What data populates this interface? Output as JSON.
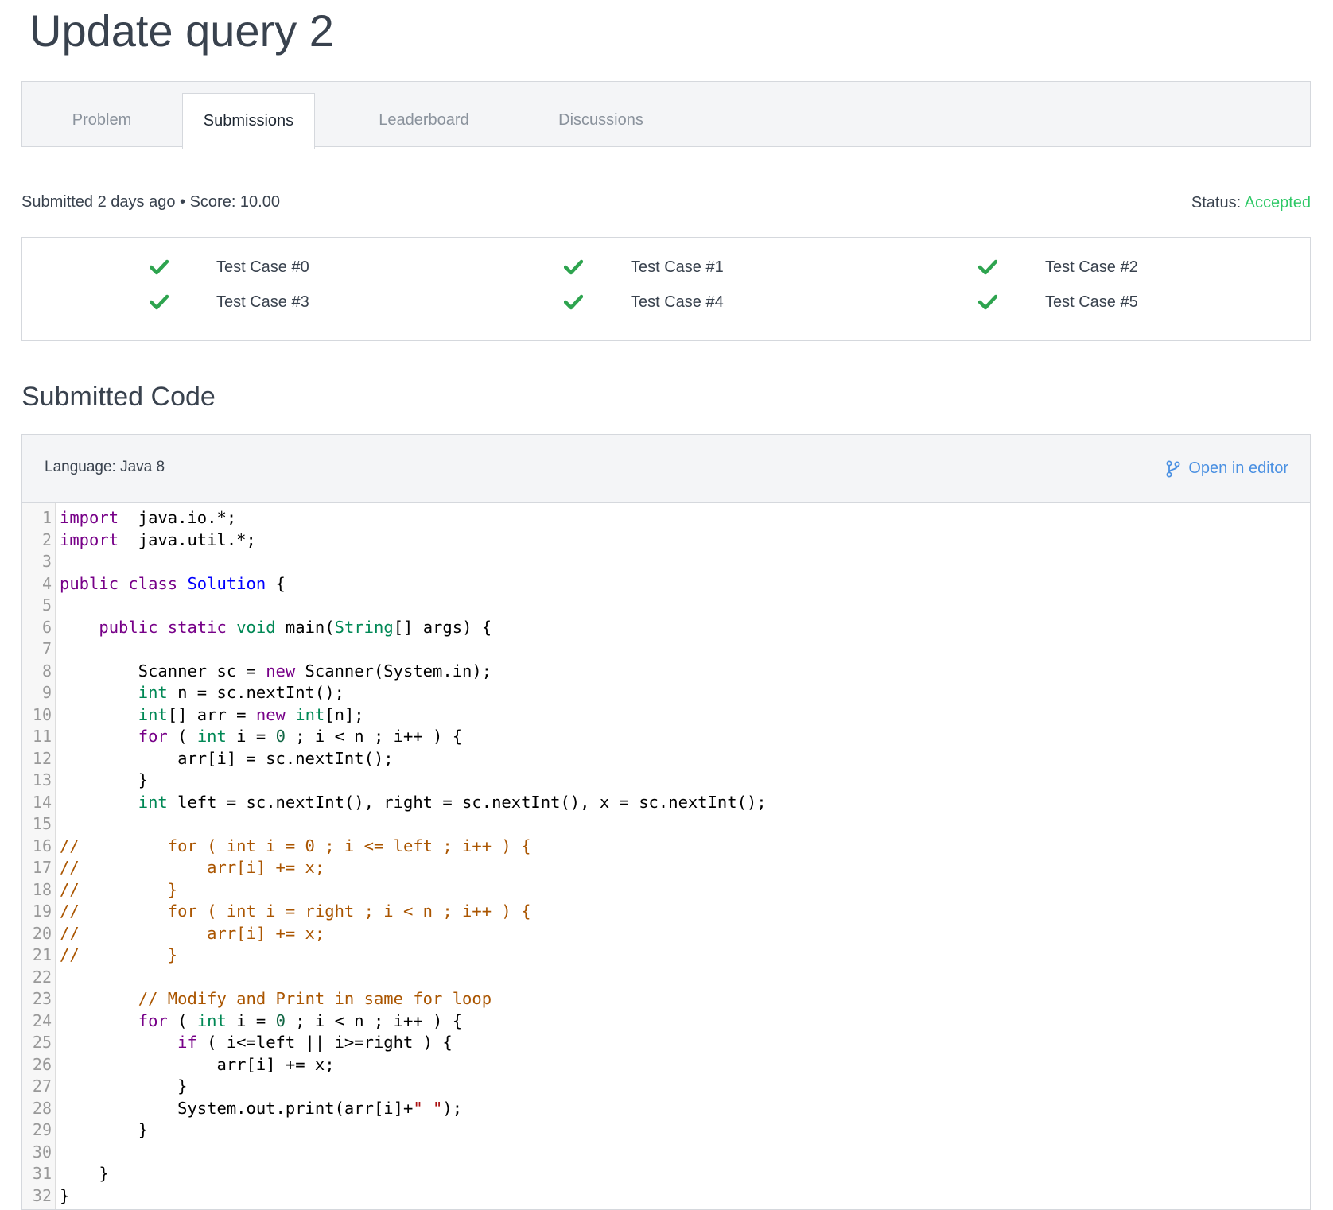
{
  "page": {
    "title": "Update query 2"
  },
  "tabs": [
    {
      "label": "Problem",
      "active": false
    },
    {
      "label": "Submissions",
      "active": true
    },
    {
      "label": "Leaderboard",
      "active": false
    },
    {
      "label": "Discussions",
      "active": false
    }
  ],
  "submission": {
    "summary": "Submitted 2 days ago • Score: 10.00",
    "status_label": "Status:",
    "status_value": "Accepted"
  },
  "test_cases": [
    {
      "label": "Test Case #0",
      "passed": true
    },
    {
      "label": "Test Case #1",
      "passed": true
    },
    {
      "label": "Test Case #2",
      "passed": true
    },
    {
      "label": "Test Case #3",
      "passed": true
    },
    {
      "label": "Test Case #4",
      "passed": true
    },
    {
      "label": "Test Case #5",
      "passed": true
    }
  ],
  "code_section": {
    "title": "Submitted Code",
    "language": "Language: Java 8",
    "open_in_editor": "Open in editor",
    "lines": [
      [
        [
          "kw",
          "import"
        ],
        [
          "",
          "  java.io.*;"
        ]
      ],
      [
        [
          "kw",
          "import"
        ],
        [
          "",
          "  java.util.*;"
        ]
      ],
      [],
      [
        [
          "kw",
          "public"
        ],
        [
          "",
          " "
        ],
        [
          "kw",
          "class"
        ],
        [
          "",
          " "
        ],
        [
          "def",
          "Solution"
        ],
        [
          "",
          " {"
        ]
      ],
      [],
      [
        [
          "",
          "    "
        ],
        [
          "kw",
          "public"
        ],
        [
          "",
          " "
        ],
        [
          "kw",
          "static"
        ],
        [
          "",
          " "
        ],
        [
          "ty",
          "void"
        ],
        [
          "",
          " main("
        ],
        [
          "ty",
          "String"
        ],
        [
          "",
          "[] args) {"
        ]
      ],
      [],
      [
        [
          "",
          "        Scanner sc = "
        ],
        [
          "kw",
          "new"
        ],
        [
          "",
          " Scanner(System.in);"
        ]
      ],
      [
        [
          "",
          "        "
        ],
        [
          "ty",
          "int"
        ],
        [
          "",
          " n = sc.nextInt();"
        ]
      ],
      [
        [
          "",
          "        "
        ],
        [
          "ty",
          "int"
        ],
        [
          "",
          "[] arr = "
        ],
        [
          "kw",
          "new"
        ],
        [
          "",
          " "
        ],
        [
          "ty",
          "int"
        ],
        [
          "",
          "[n];"
        ]
      ],
      [
        [
          "",
          "        "
        ],
        [
          "kw",
          "for"
        ],
        [
          "",
          " ( "
        ],
        [
          "ty",
          "int"
        ],
        [
          "",
          " i = "
        ],
        [
          "num",
          "0"
        ],
        [
          "",
          " ; i < n ; i++ ) {"
        ]
      ],
      [
        [
          "",
          "            arr[i] = sc.nextInt();"
        ]
      ],
      [
        [
          "",
          "        }"
        ]
      ],
      [
        [
          "",
          "        "
        ],
        [
          "ty",
          "int"
        ],
        [
          "",
          " left = sc.nextInt(), right = sc.nextInt(), x = sc.nextInt();"
        ]
      ],
      [],
      [
        [
          "cm",
          "//         for ( int i = 0 ; i <= left ; i++ ) {"
        ]
      ],
      [
        [
          "cm",
          "//             arr[i] += x;"
        ]
      ],
      [
        [
          "cm",
          "//         }"
        ]
      ],
      [
        [
          "cm",
          "//         for ( int i = right ; i < n ; i++ ) {"
        ]
      ],
      [
        [
          "cm",
          "//             arr[i] += x;"
        ]
      ],
      [
        [
          "cm",
          "//         }"
        ]
      ],
      [],
      [
        [
          "",
          "        "
        ],
        [
          "cm",
          "// Modify and Print in same for loop"
        ]
      ],
      [
        [
          "",
          "        "
        ],
        [
          "kw",
          "for"
        ],
        [
          "",
          " ( "
        ],
        [
          "ty",
          "int"
        ],
        [
          "",
          " i = "
        ],
        [
          "num",
          "0"
        ],
        [
          "",
          " ; i < n ; i++ ) {"
        ]
      ],
      [
        [
          "",
          "            "
        ],
        [
          "kw",
          "if"
        ],
        [
          "",
          " ( i<=left || i>=right ) {"
        ]
      ],
      [
        [
          "",
          "                arr[i] += x;"
        ]
      ],
      [
        [
          "",
          "            }"
        ]
      ],
      [
        [
          "",
          "            System.out.print(arr[i]+"
        ],
        [
          "str",
          "\" \""
        ],
        [
          "",
          ");"
        ]
      ],
      [
        [
          "",
          "        }"
        ]
      ],
      [],
      [
        [
          "",
          "    }"
        ]
      ],
      [
        [
          "",
          "}"
        ]
      ]
    ]
  },
  "colors": {
    "accepted": "#2ec866",
    "check": "#2ea44f",
    "link": "#4a90e2"
  },
  "icons": {
    "check": "check-icon",
    "branch": "git-branch-icon"
  }
}
